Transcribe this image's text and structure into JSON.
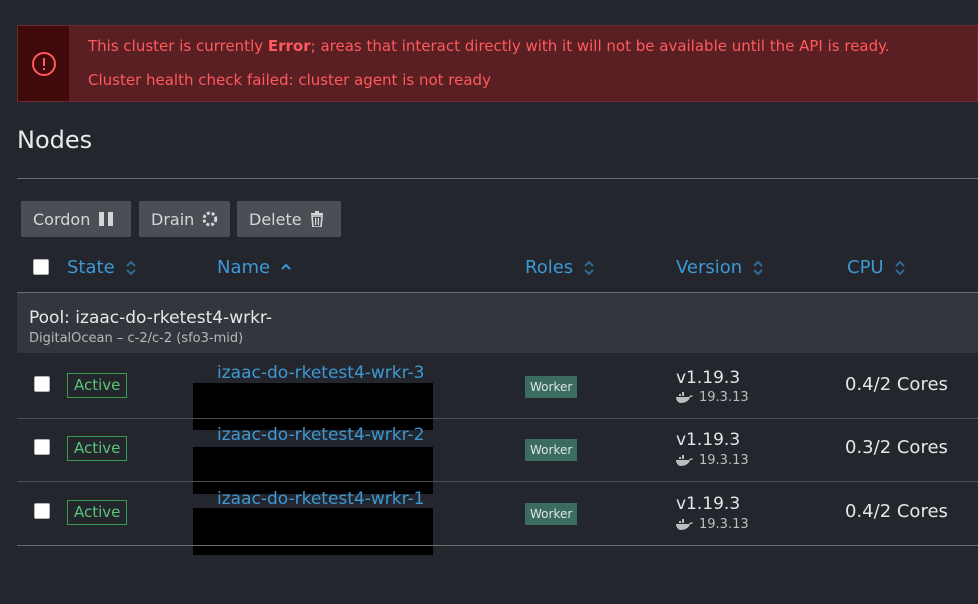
{
  "banner": {
    "line1_prefix": "This cluster is currently ",
    "line1_state": "Error",
    "line1_suffix": "; areas that interact directly with it will not be available until the API is ready.",
    "line2": "Cluster health check failed: cluster agent is not ready",
    "icon": "alert-circle-icon",
    "color": "#ff5a5f"
  },
  "page": {
    "title": "Nodes"
  },
  "toolbar": {
    "cordon": "Cordon",
    "drain": "Drain",
    "delete": "Delete"
  },
  "table": {
    "headers": {
      "state": "State",
      "name": "Name",
      "roles": "Roles",
      "version": "Version",
      "cpu": "CPU"
    },
    "pool": {
      "title": "Pool: izaac-do-rketest4-wrkr-",
      "subtitle": "DigitalOcean – c-2/c-2 (sfo3-mid)"
    },
    "rows": [
      {
        "state": "Active",
        "name": "izaac-do-rketest4-wrkr-3",
        "role": "Worker",
        "version": "v1.19.3",
        "docker": "19.3.13",
        "cpu": "0.4/2 Cores"
      },
      {
        "state": "Active",
        "name": "izaac-do-rketest4-wrkr-2",
        "role": "Worker",
        "version": "v1.19.3",
        "docker": "19.3.13",
        "cpu": "0.3/2 Cores"
      },
      {
        "state": "Active",
        "name": "izaac-do-rketest4-wrkr-1",
        "role": "Worker",
        "version": "v1.19.3",
        "docker": "19.3.13",
        "cpu": "0.4/2 Cores"
      }
    ]
  },
  "colors": {
    "accent": "#3d98d3",
    "active": "#5ac477",
    "error_bg": "#5a1f22"
  }
}
